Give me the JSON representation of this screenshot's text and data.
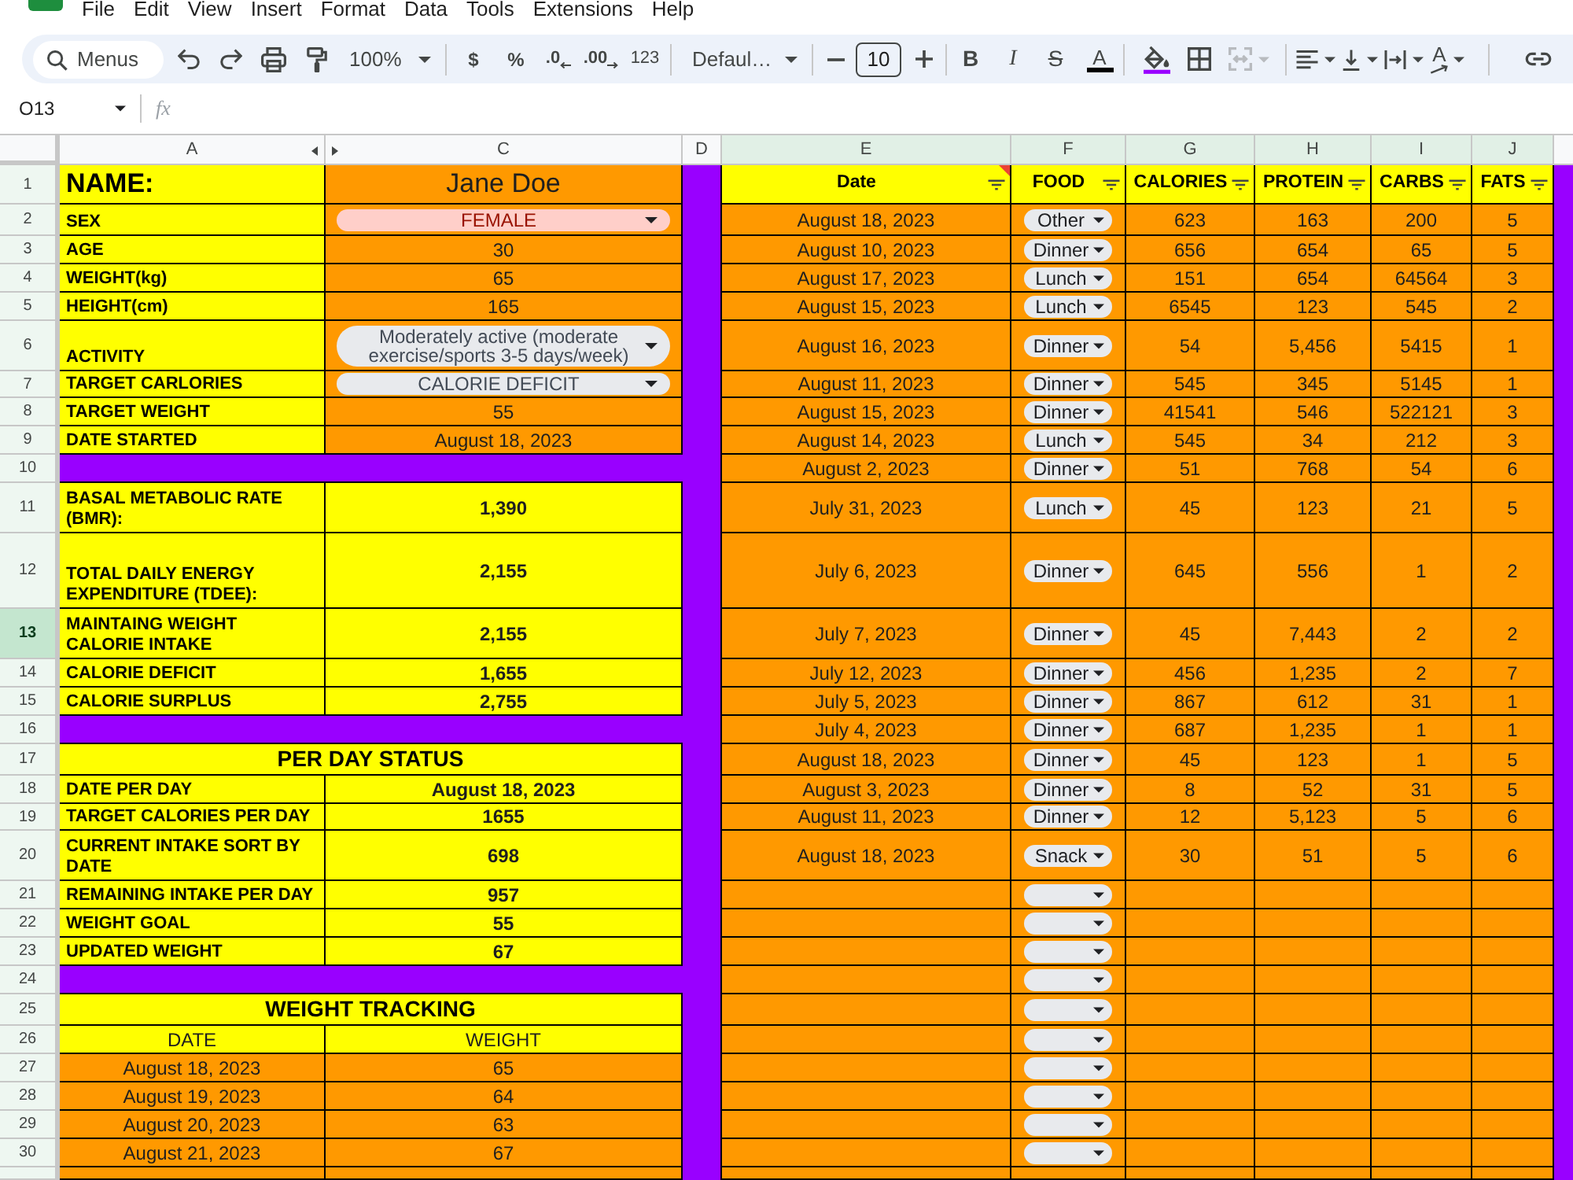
{
  "menu_bar": [
    "File",
    "Edit",
    "View",
    "Insert",
    "Format",
    "Data",
    "Tools",
    "Extensions",
    "Help"
  ],
  "toolbar": {
    "search": {
      "placeholder": "Menus"
    },
    "zoom": "100%",
    "currency": "$",
    "percent": "%",
    "decrease_decimal": ".0",
    "increase_decimal": ".00",
    "number_format": "123",
    "font": "Defaul…",
    "font_size": "10",
    "bold": "B",
    "italic": "I",
    "strikethrough": "S",
    "text_color": "A",
    "text_rotation": "A"
  },
  "formula_bar": {
    "cell_ref": "O13",
    "fx": "fx"
  },
  "columns": [
    {
      "letter": "A",
      "filtered": false,
      "hidden_next": true
    },
    {
      "letter": "C",
      "filtered": false,
      "hidden_next": false
    },
    {
      "letter": "D",
      "filtered": false,
      "hidden_next": false
    },
    {
      "letter": "E",
      "filtered": true,
      "hidden_next": false
    },
    {
      "letter": "F",
      "filtered": true,
      "hidden_next": false
    },
    {
      "letter": "G",
      "filtered": true,
      "hidden_next": false
    },
    {
      "letter": "H",
      "filtered": true,
      "hidden_next": false
    },
    {
      "letter": "I",
      "filtered": true,
      "hidden_next": false
    },
    {
      "letter": "J",
      "filtered": true,
      "hidden_next": false
    }
  ],
  "rows": [
    {
      "number": "1",
      "highlighted": false,
      "profile": {
        "kind": "title",
        "label": "NAME:",
        "value": "Jane Doe"
      },
      "log": {
        "kind": "header",
        "cells": [
          {
            "label": "Date",
            "note": true
          },
          {
            "label": "FOOD",
            "note": false
          },
          {
            "label": "CALORIES",
            "note": false
          },
          {
            "label": "PROTEIN",
            "note": false
          },
          {
            "label": "CARBS",
            "note": false
          },
          {
            "label": "FATS",
            "note": false
          }
        ]
      }
    },
    {
      "number": "2",
      "highlighted": false,
      "profile": {
        "kind": "dropdown",
        "label": "SEX",
        "value": "FEMALE",
        "color": "#ffcfc9"
      },
      "log": {
        "kind": "entry",
        "date": "August 18, 2023",
        "food": "Other",
        "calories": "623",
        "protein": "163",
        "carbs": "200",
        "fats": "5"
      }
    },
    {
      "number": "3",
      "highlighted": false,
      "profile": {
        "kind": "input",
        "label": "AGE",
        "value": "30"
      },
      "log": {
        "kind": "entry",
        "date": "August 10, 2023",
        "food": "Dinner",
        "calories": "656",
        "protein": "654",
        "carbs": "65",
        "fats": "5"
      }
    },
    {
      "number": "4",
      "highlighted": false,
      "profile": {
        "kind": "input",
        "label": "WEIGHT(kg)",
        "value": "65"
      },
      "log": {
        "kind": "entry",
        "date": "August 17, 2023",
        "food": "Lunch",
        "calories": "151",
        "protein": "654",
        "carbs": "64564",
        "fats": "3"
      }
    },
    {
      "number": "5",
      "highlighted": false,
      "profile": {
        "kind": "input",
        "label": "HEIGHT(cm)",
        "value": "165"
      },
      "log": {
        "kind": "entry",
        "date": "August 15, 2023",
        "food": "Lunch",
        "calories": "6545",
        "protein": "123",
        "carbs": "545",
        "fats": "2"
      }
    },
    {
      "number": "6",
      "highlighted": false,
      "profile": {
        "kind": "dropdown",
        "label": "ACTIVITY",
        "value": "Moderately active (moderate exercise/sports 3-5 days/week)",
        "color": "#e8eaed"
      },
      "log": {
        "kind": "entry",
        "date": "August 16, 2023",
        "food": "Dinner",
        "calories": "54",
        "protein": "5,456",
        "carbs": "5415",
        "fats": "1"
      }
    },
    {
      "number": "7",
      "highlighted": false,
      "profile": {
        "kind": "dropdown",
        "label": "TARGET CARLORIES",
        "value": "CALORIE DEFICIT",
        "color": "#e8eaed"
      },
      "log": {
        "kind": "entry",
        "date": "August 11, 2023",
        "food": "Dinner",
        "calories": "545",
        "protein": "345",
        "carbs": "5145",
        "fats": "1"
      }
    },
    {
      "number": "8",
      "highlighted": false,
      "profile": {
        "kind": "input",
        "label": "TARGET WEIGHT",
        "value": "55"
      },
      "log": {
        "kind": "entry",
        "date": "August 15, 2023",
        "food": "Dinner",
        "calories": "41541",
        "protein": "546",
        "carbs": "522121",
        "fats": "3"
      }
    },
    {
      "number": "9",
      "highlighted": false,
      "profile": {
        "kind": "input",
        "label": "DATE STARTED",
        "value": "August 18, 2023"
      },
      "log": {
        "kind": "entry",
        "date": "August 14, 2023",
        "food": "Lunch",
        "calories": "545",
        "protein": "34",
        "carbs": "212",
        "fats": "3"
      }
    },
    {
      "number": "10",
      "highlighted": false,
      "profile": {
        "kind": "separator"
      },
      "log": {
        "kind": "entry",
        "date": "August 2, 2023",
        "food": "Dinner",
        "calories": "51",
        "protein": "768",
        "carbs": "54",
        "fats": "6"
      }
    },
    {
      "number": "11",
      "highlighted": false,
      "profile": {
        "kind": "metric",
        "label": "BASAL METABOLIC RATE (BMR):",
        "value": "1,390"
      },
      "log": {
        "kind": "entry",
        "date": "July 31, 2023",
        "food": "Lunch",
        "calories": "45",
        "protein": "123",
        "carbs": "21",
        "fats": "5"
      }
    },
    {
      "number": "12",
      "highlighted": false,
      "profile": {
        "kind": "metric",
        "label": "TOTAL DAILY ENERGY EXPENDITURE (TDEE):",
        "value": "2,155"
      },
      "log": {
        "kind": "entry",
        "date": "July 6, 2023",
        "food": "Dinner",
        "calories": "645",
        "protein": "556",
        "carbs": "1",
        "fats": "2"
      }
    },
    {
      "number": "13",
      "highlighted": true,
      "profile": {
        "kind": "metric",
        "label": "MAINTAING WEIGHT CALORIE INTAKE",
        "value": "2,155"
      },
      "log": {
        "kind": "entry",
        "date": "July 7, 2023",
        "food": "Dinner",
        "calories": "45",
        "protein": "7,443",
        "carbs": "2",
        "fats": "2"
      }
    },
    {
      "number": "14",
      "highlighted": false,
      "profile": {
        "kind": "metric",
        "label": "CALORIE DEFICIT",
        "value": "1,655"
      },
      "log": {
        "kind": "entry",
        "date": "July 12, 2023",
        "food": "Dinner",
        "calories": "456",
        "protein": "1,235",
        "carbs": "2",
        "fats": "7"
      }
    },
    {
      "number": "15",
      "highlighted": false,
      "profile": {
        "kind": "metric",
        "label": "CALORIE SURPLUS",
        "value": "2,755"
      },
      "log": {
        "kind": "entry",
        "date": "July 5, 2023",
        "food": "Dinner",
        "calories": "867",
        "protein": "612",
        "carbs": "31",
        "fats": "1"
      }
    },
    {
      "number": "16",
      "highlighted": false,
      "profile": {
        "kind": "separator"
      },
      "log": {
        "kind": "entry",
        "date": "July 4, 2023",
        "food": "Dinner",
        "calories": "687",
        "protein": "1,235",
        "carbs": "1",
        "fats": "1"
      }
    },
    {
      "number": "17",
      "highlighted": false,
      "profile": {
        "kind": "section",
        "label": "PER DAY STATUS"
      },
      "log": {
        "kind": "entry",
        "date": "August 18, 2023",
        "food": "Dinner",
        "calories": "45",
        "protein": "123",
        "carbs": "1",
        "fats": "5"
      }
    },
    {
      "number": "18",
      "highlighted": false,
      "profile": {
        "kind": "metric",
        "label": "DATE PER DAY",
        "value": "August 18, 2023"
      },
      "log": {
        "kind": "entry",
        "date": "August 3, 2023",
        "food": "Dinner",
        "calories": "8",
        "protein": "52",
        "carbs": "31",
        "fats": "5"
      }
    },
    {
      "number": "19",
      "highlighted": false,
      "profile": {
        "kind": "metric",
        "label": "TARGET CALORIES PER DAY",
        "value": "1655"
      },
      "log": {
        "kind": "entry",
        "date": "August 11, 2023",
        "food": "Dinner",
        "calories": "12",
        "protein": "5,123",
        "carbs": "5",
        "fats": "6"
      }
    },
    {
      "number": "20",
      "highlighted": false,
      "profile": {
        "kind": "metric",
        "label": "CURRENT INTAKE SORT BY DATE",
        "value": "698"
      },
      "log": {
        "kind": "entry",
        "date": "August 18, 2023",
        "food": "Snack",
        "calories": "30",
        "protein": "51",
        "carbs": "5",
        "fats": "6"
      }
    },
    {
      "number": "21",
      "highlighted": false,
      "profile": {
        "kind": "metric",
        "label": "REMAINING INTAKE PER DAY",
        "value": "957"
      },
      "log": {
        "kind": "blank"
      }
    },
    {
      "number": "22",
      "highlighted": false,
      "profile": {
        "kind": "metric",
        "label": "WEIGHT GOAL",
        "value": "55"
      },
      "log": {
        "kind": "blank"
      }
    },
    {
      "number": "23",
      "highlighted": false,
      "profile": {
        "kind": "metric",
        "label": "UPDATED WEIGHT",
        "value": "67"
      },
      "log": {
        "kind": "blank"
      }
    },
    {
      "number": "24",
      "highlighted": false,
      "profile": {
        "kind": "separator"
      },
      "log": {
        "kind": "blank"
      }
    },
    {
      "number": "25",
      "highlighted": false,
      "profile": {
        "kind": "section",
        "label": "WEIGHT TRACKING"
      },
      "log": {
        "kind": "blank"
      }
    },
    {
      "number": "26",
      "highlighted": false,
      "profile": {
        "kind": "subheader",
        "label": "DATE",
        "value": "WEIGHT"
      },
      "log": {
        "kind": "blank"
      }
    },
    {
      "number": "27",
      "highlighted": false,
      "profile": {
        "kind": "tracking",
        "label": "August 18, 2023",
        "value": "65"
      },
      "log": {
        "kind": "blank"
      }
    },
    {
      "number": "28",
      "highlighted": false,
      "profile": {
        "kind": "tracking",
        "label": "August 19, 2023",
        "value": "64"
      },
      "log": {
        "kind": "blank"
      }
    },
    {
      "number": "29",
      "highlighted": false,
      "profile": {
        "kind": "tracking",
        "label": "August 20, 2023",
        "value": "63"
      },
      "log": {
        "kind": "blank"
      }
    },
    {
      "number": "30",
      "highlighted": false,
      "profile": {
        "kind": "tracking",
        "label": "August 21, 2023",
        "value": "67"
      },
      "log": {
        "kind": "blank"
      }
    },
    {
      "profile": {
        "kind": "empty"
      },
      "log": {
        "kind": "empty"
      }
    }
  ]
}
